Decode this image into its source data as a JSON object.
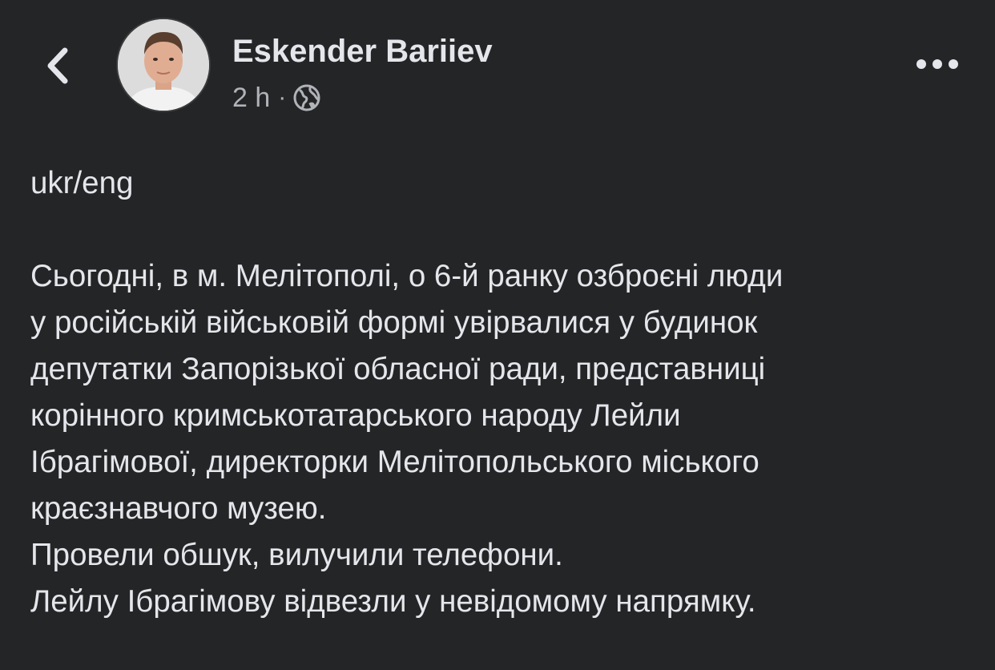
{
  "header": {
    "author_name": "Eskender Bariiev",
    "time": "2 h",
    "separator": "·",
    "privacy_icon": "globe-icon",
    "back_icon": "chevron-left-icon",
    "more_icon": "more-dots-icon"
  },
  "post": {
    "lines": [
      "ukr/eng",
      "",
      "Сьогодні, в м. Мелітополі, о 6-й ранку озброєні люди",
      "у російській військовій формі увірвалися у будинок",
      "депутатки Запорізької обласної ради, представниці",
      "корінного кримськотатарського народу Лейли",
      "Ібрагімової, директорки Мелітопольського міського",
      "краєзнавчого музею.",
      "Провели обшук, вилучили телефони.",
      "Лейлу Ібрагімову відвезли у невідомому напрямку."
    ]
  },
  "colors": {
    "background": "#242526",
    "primary_text": "#e4e6eb",
    "secondary_text": "#b0b3b8"
  }
}
